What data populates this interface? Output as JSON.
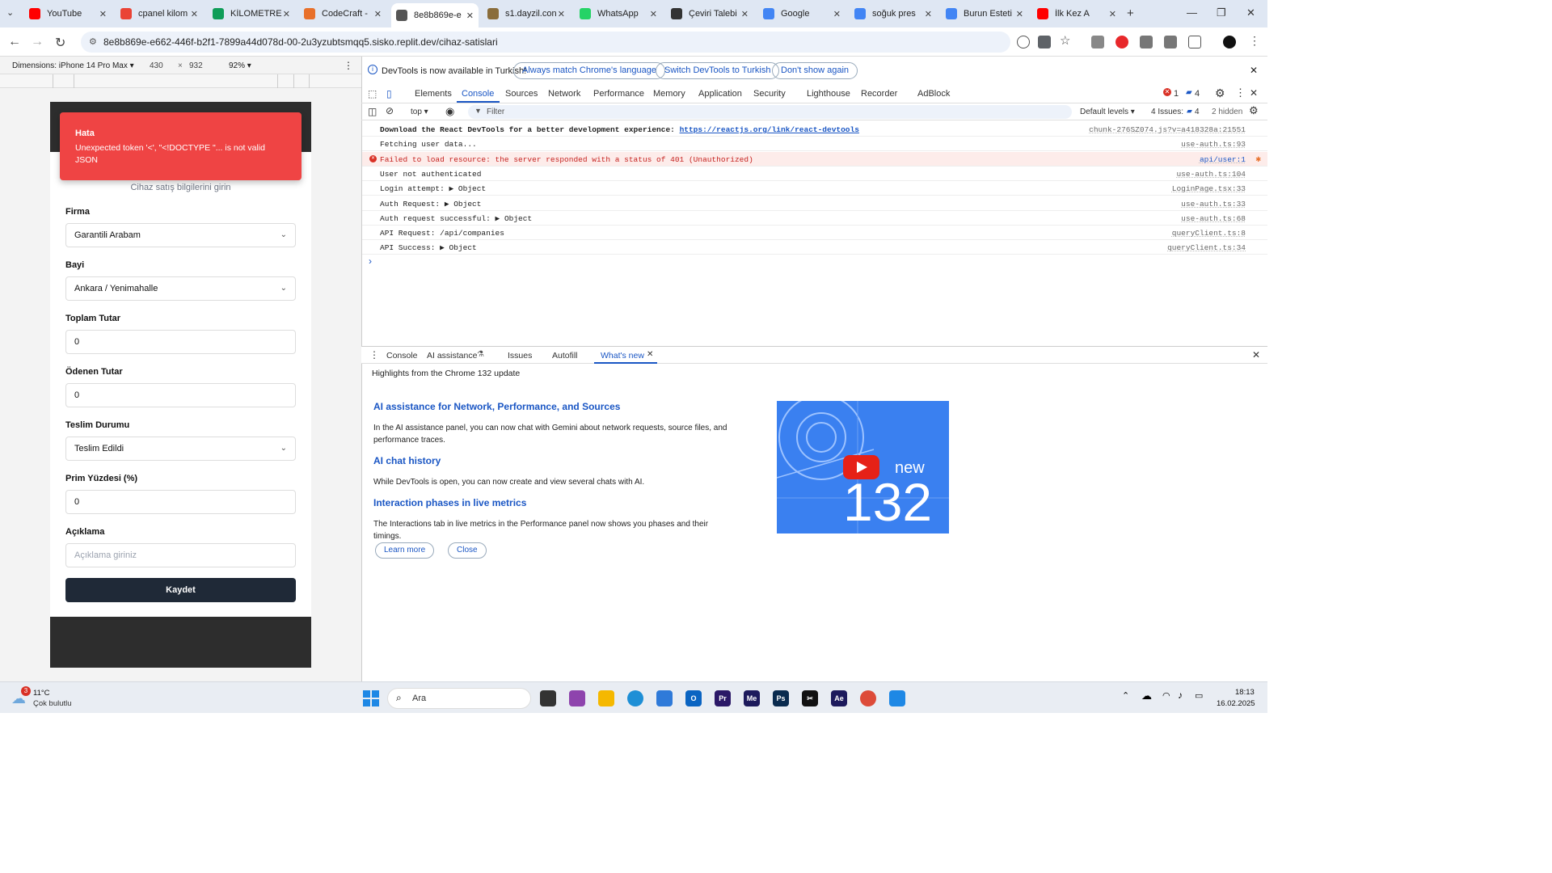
{
  "browser": {
    "tabs": [
      {
        "title": "YouTube",
        "icon": "youtube-icon",
        "color": "#ff0000"
      },
      {
        "title": "cpanel kilom",
        "icon": "gmail-icon",
        "color": "#ea4335"
      },
      {
        "title": "KİLOMETRE",
        "icon": "sheets-icon",
        "color": "#0f9d58"
      },
      {
        "title": "CodeCraft -",
        "icon": "codecraft-icon",
        "color": "#e8702a"
      },
      {
        "title": "8e8b869e-e",
        "icon": "globe-icon",
        "color": "#555555",
        "active": true
      },
      {
        "title": "s1.dayzil.con",
        "icon": "dayzil-icon",
        "color": "#8a6d3b"
      },
      {
        "title": "WhatsApp",
        "icon": "whatsapp-icon",
        "color": "#25d366"
      },
      {
        "title": "Çeviri Talebi",
        "icon": "ceviri-icon",
        "color": "#333333"
      },
      {
        "title": "Google",
        "icon": "google-icon",
        "color": "#4285f4"
      },
      {
        "title": "soğuk pres",
        "icon": "google-icon",
        "color": "#4285f4"
      },
      {
        "title": "Burun Esteti",
        "icon": "google-icon",
        "color": "#4285f4"
      },
      {
        "title": "İlk Kez A",
        "icon": "youtube-icon",
        "color": "#ff0000"
      }
    ],
    "url": "8e8b869e-e662-446f-b2f1-7899a44d078d-00-2u3yzubtsmqq5.sisko.replit.dev/cihaz-satislari"
  },
  "device_toolbar": {
    "dimensions": "Dimensions: iPhone 14 Pro Max ▾",
    "width": "430",
    "times": "×",
    "height": "932",
    "zoom": "92% ▾"
  },
  "app": {
    "error_toast": {
      "title": "Hata",
      "message": "Unexpected token '<', \"<!DOCTYPE \"... is not valid JSON"
    },
    "subtitle": "Cihaz satış bilgilerini girin",
    "fields": [
      {
        "label": "Firma",
        "value": "Garantili Arabam",
        "type": "select"
      },
      {
        "label": "Bayi",
        "value": "Ankara / Yenimahalle",
        "type": "select"
      },
      {
        "label": "Toplam Tutar",
        "value": "0",
        "type": "input"
      },
      {
        "label": "Ödenen Tutar",
        "value": "0",
        "type": "input"
      },
      {
        "label": "Teslim Durumu",
        "value": "Teslim Edildi",
        "type": "select"
      },
      {
        "label": "Prim Yüzdesi (%)",
        "value": "0",
        "type": "input"
      },
      {
        "label": "Açıklama",
        "placeholder": "Açıklama giriniz",
        "type": "input"
      }
    ],
    "save_label": "Kaydet"
  },
  "devtools": {
    "infobar": {
      "text": "DevTools is now available in Turkish!",
      "btn1": "Always match Chrome's language",
      "btn2": "Switch DevTools to Turkish",
      "btn3": "Don't show again"
    },
    "tabs": [
      "Elements",
      "Console",
      "Sources",
      "Network",
      "Performance",
      "Memory",
      "Application",
      "Security",
      "Lighthouse",
      "Recorder",
      "AdBlock"
    ],
    "active_tab": "Console",
    "error_count": "1",
    "message_count": "4",
    "toolbar": {
      "context": "top ▾",
      "filter": "Filter",
      "levels": "Default levels ▾",
      "issues": "4 Issues:",
      "issues_count": "4",
      "hidden": "2 hidden"
    },
    "console_rows": [
      {
        "msg": "Download the React DevTools for a better development experience: ",
        "link": "https://reactjs.org/link/react-devtools",
        "src": "chunk-276SZ074.js?v=a418328a:21551",
        "bold": true
      },
      {
        "msg": "Fetching user data...",
        "src": "use-auth.ts:93"
      },
      {
        "msg": "Failed to load resource: the server responded with a status of 401 (Unauthorized)",
        "src": "api/user:1",
        "error": true
      },
      {
        "msg": "User not authenticated",
        "src": "use-auth.ts:104"
      },
      {
        "msg": "Login attempt: ▶ Object",
        "src": "LoginPage.tsx:33"
      },
      {
        "msg": "Auth Request: ▶ Object",
        "src": "use-auth.ts:33"
      },
      {
        "msg": "Auth request successful: ▶ Object",
        "src": "use-auth.ts:68"
      },
      {
        "msg": "API Request: /api/companies",
        "src": "queryClient.ts:8"
      },
      {
        "msg": "API Success: ▶ Object",
        "src": "queryClient.ts:34"
      }
    ],
    "prompt": "›",
    "drawer_tabs": [
      "Console",
      "AI assistance",
      "Issues",
      "Autofill",
      "What's new"
    ],
    "whats_new": {
      "header": "Highlights from the Chrome 132 update",
      "sections": [
        {
          "title": "AI assistance for Network, Performance, and Sources",
          "body": "In the AI assistance panel, you can now chat with Gemini about network requests, source files, and performance traces."
        },
        {
          "title": "AI chat history",
          "body": "While DevTools is open, you can now create and view several chats with AI."
        },
        {
          "title": "Interaction phases in live metrics",
          "body": "The Interactions tab in live metrics in the Performance panel now shows you phases and their timings."
        }
      ],
      "learn_more": "Learn more",
      "close": "Close",
      "promo_new": "new",
      "promo_version": "132"
    }
  },
  "taskbar": {
    "weather_badge": "3",
    "temperature": "11°C",
    "condition": "Çok bulutlu",
    "search": "Ara",
    "time": "18:13",
    "date": "16.02.2025"
  }
}
